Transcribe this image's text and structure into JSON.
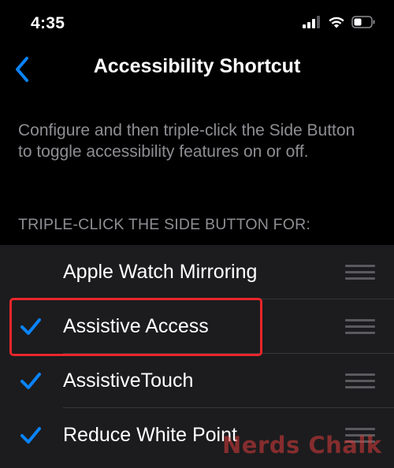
{
  "status_bar": {
    "time": "4:35",
    "icons": [
      "cellular-signal-icon",
      "wifi-icon",
      "battery-icon"
    ]
  },
  "nav": {
    "back_icon": "chevron-left-icon",
    "title": "Accessibility Shortcut"
  },
  "description": "Configure and then triple-click the Side Button to toggle accessibility features on or off.",
  "section_header": "TRIPLE-CLICK THE SIDE BUTTON FOR:",
  "features": [
    {
      "label": "Apple Watch Mirroring",
      "checked": false
    },
    {
      "label": "Assistive Access",
      "checked": true
    },
    {
      "label": "AssistiveTouch",
      "checked": true
    },
    {
      "label": "Reduce White Point",
      "checked": true
    }
  ],
  "watermark": "Nerds Chalk",
  "colors": {
    "accent": "#0a84ff",
    "background": "#000000",
    "list_background": "#1c1c1e",
    "secondary_text": "#8e8e93",
    "highlight": "#e8262a"
  }
}
